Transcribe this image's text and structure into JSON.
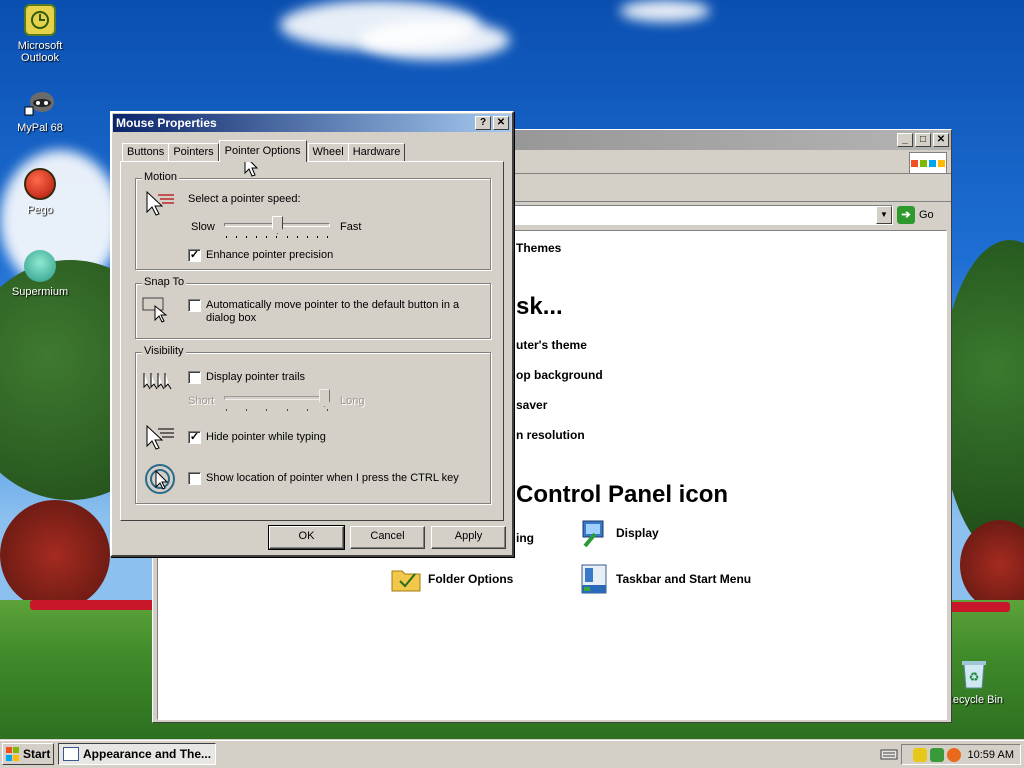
{
  "desktop": {
    "icons": [
      {
        "name": "Microsoft Outlook",
        "line1": "Microsoft",
        "line2": "Outlook"
      },
      {
        "name": "MyPal 68",
        "line1": "MyPal 68",
        "line2": ""
      },
      {
        "name": "Pego",
        "line1": "Pego",
        "line2": ""
      },
      {
        "name": "Supermium",
        "line1": "Supermium",
        "line2": ""
      },
      {
        "name": "Recycle Bin",
        "line1": "Recycle Bin",
        "line2": ""
      }
    ]
  },
  "explorer": {
    "go_label": "Go",
    "links": {
      "themes": "Themes",
      "theme": "uter's theme",
      "background": "op background",
      "saver": "saver",
      "resolution": "n resolution"
    },
    "heading_task": "sk...",
    "heading_icon": "Control Panel icon",
    "items": {
      "partial": "ing",
      "display": "Display",
      "folder_options": "Folder Options",
      "taskbar": "Taskbar and Start Menu"
    }
  },
  "dialog": {
    "title": "Mouse Properties",
    "help_btn": "?",
    "close_btn": "✕",
    "tabs": [
      "Buttons",
      "Pointers",
      "Pointer Options",
      "Wheel",
      "Hardware"
    ],
    "active_tab": "Pointer Options",
    "motion": {
      "legend": "Motion",
      "speed_label": "Select a pointer speed:",
      "slow": "Slow",
      "fast": "Fast",
      "speed_value": 0.5,
      "precision_label": "Enhance pointer precision",
      "precision_checked": true
    },
    "snap": {
      "legend": "Snap To",
      "line1": "Automatically move pointer to the default button in a",
      "line2": "dialog box",
      "checked": false
    },
    "visibility": {
      "legend": "Visibility",
      "trails_label": "Display pointer trails",
      "trails_checked": false,
      "short": "Short",
      "long": "Long",
      "trails_value": 1.0,
      "hide_label": "Hide pointer while typing",
      "hide_checked": true,
      "ctrl_label": "Show location of pointer when I press the CTRL key",
      "ctrl_checked": false
    },
    "buttons": {
      "ok": "OK",
      "cancel": "Cancel",
      "apply": "Apply"
    }
  },
  "taskbar": {
    "start": "Start",
    "task": "Appearance and The...",
    "clock": "10:59 AM"
  },
  "colors": {
    "title_active": "#0a246a",
    "face": "#d4d0c8",
    "desktop_sky": "#1e6fd4"
  }
}
